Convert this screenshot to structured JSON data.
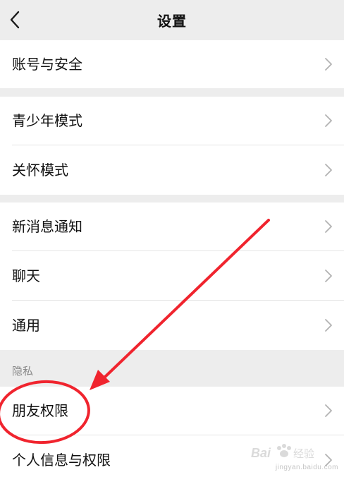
{
  "header": {
    "title": "设置",
    "back_icon": "chevron-left-icon"
  },
  "groups": {
    "account": {
      "items": [
        {
          "label": "账号与安全"
        }
      ]
    },
    "modes": {
      "items": [
        {
          "label": "青少年模式"
        },
        {
          "label": "关怀模式"
        }
      ]
    },
    "general": {
      "items": [
        {
          "label": "新消息通知"
        },
        {
          "label": "聊天"
        },
        {
          "label": "通用"
        }
      ]
    },
    "privacy": {
      "section_label": "隐私",
      "items": [
        {
          "label": "朋友权限"
        },
        {
          "label": "个人信息与权限"
        }
      ]
    }
  },
  "annotation": {
    "color": "#f0242e",
    "highlight_target": "朋友权限"
  },
  "watermark": {
    "logo_text": "Baidu 经验",
    "url": "jingyan.baidu.com"
  },
  "colors": {
    "background": "#ededed",
    "row": "#ffffff",
    "text": "#111111",
    "chevron": "#b2b2b2"
  }
}
